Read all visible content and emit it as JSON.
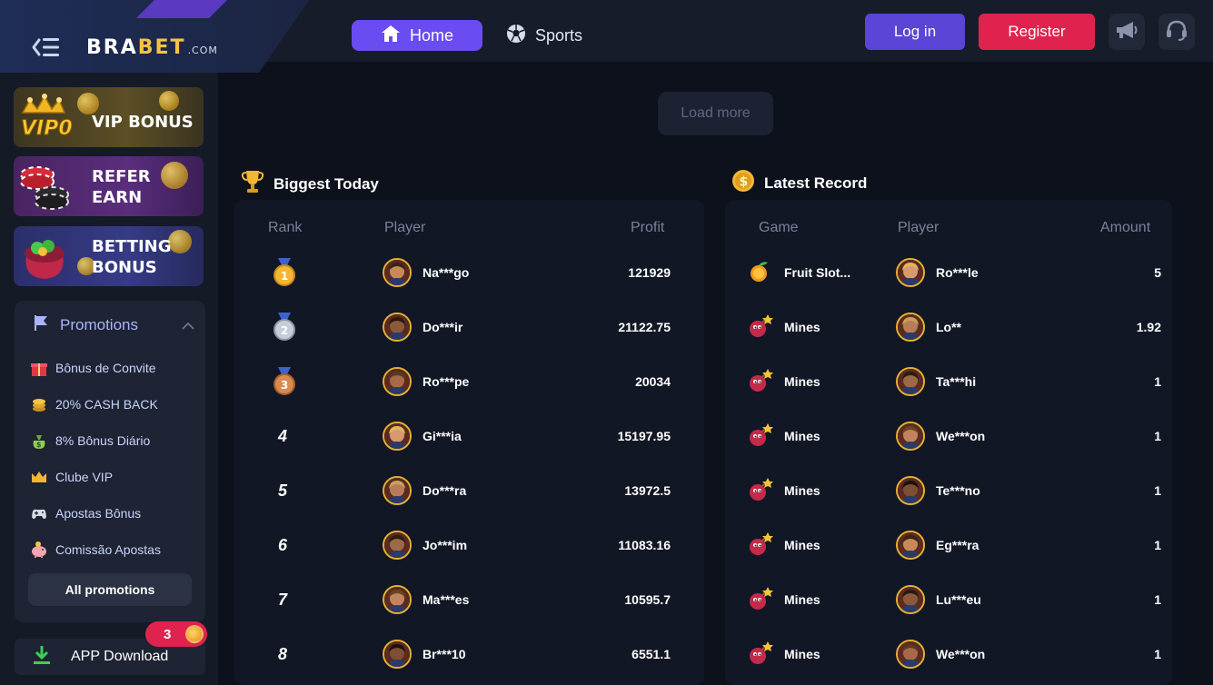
{
  "header": {
    "logo_main": "BRA",
    "logo_accent": "BET",
    "logo_suffix": ".COM",
    "nav_home": "Home",
    "nav_sports": "Sports",
    "login": "Log in",
    "register": "Register"
  },
  "sidebar": {
    "banners": [
      {
        "label_line1": "VIP BONUS",
        "label_line2": ""
      },
      {
        "label_line1": "REFER",
        "label_line2": "EARN"
      },
      {
        "label_line1": "BETTING",
        "label_line2": "BONUS"
      }
    ],
    "vip_badge_text": "VIP0",
    "promotions_title": "Promotions",
    "promotions": [
      {
        "label": "Bônus de Convite",
        "icon": "gift-icon"
      },
      {
        "label": "20% CASH BACK",
        "icon": "coin-stack-icon"
      },
      {
        "label": "8% Bônus Diário",
        "icon": "money-bag-icon"
      },
      {
        "label": "Clube VIP",
        "icon": "crown-icon"
      },
      {
        "label": "Apostas Bônus",
        "icon": "gamepad-icon"
      },
      {
        "label": "Comissão Apostas",
        "icon": "piggy-bank-icon"
      }
    ],
    "all_promotions": "All promotions",
    "app_download": "APP Download",
    "app_badge_count": "3"
  },
  "main": {
    "load_more": "Load more",
    "biggest_today": {
      "title": "Biggest Today",
      "headers": {
        "rank": "Rank",
        "player": "Player",
        "profit": "Profit"
      },
      "rows": [
        {
          "rank": "1",
          "player": "Na***go",
          "profit": "121929"
        },
        {
          "rank": "2",
          "player": "Do***ir",
          "profit": "21122.75"
        },
        {
          "rank": "3",
          "player": "Ro***pe",
          "profit": "20034"
        },
        {
          "rank": "4",
          "player": "Gi***ia",
          "profit": "15197.95"
        },
        {
          "rank": "5",
          "player": "Do***ra",
          "profit": "13972.5"
        },
        {
          "rank": "6",
          "player": "Jo***im",
          "profit": "11083.16"
        },
        {
          "rank": "7",
          "player": "Ma***es",
          "profit": "10595.7"
        },
        {
          "rank": "8",
          "player": "Br***10",
          "profit": "6551.1"
        }
      ]
    },
    "latest_record": {
      "title": "Latest Record",
      "headers": {
        "game": "Game",
        "player": "Player",
        "amount": "Amount"
      },
      "rows": [
        {
          "game": "Fruit Slot...",
          "player": "Ro***le",
          "amount": "5"
        },
        {
          "game": "Mines",
          "player": "Lo**",
          "amount": "1.92"
        },
        {
          "game": "Mines",
          "player": "Ta***hi",
          "amount": "1"
        },
        {
          "game": "Mines",
          "player": "We***on",
          "amount": "1"
        },
        {
          "game": "Mines",
          "player": "Te***no",
          "amount": "1"
        },
        {
          "game": "Mines",
          "player": "Eg***ra",
          "amount": "1"
        },
        {
          "game": "Mines",
          "player": "Lu***eu",
          "amount": "1"
        },
        {
          "game": "Mines",
          "player": "We***on",
          "amount": "1"
        }
      ]
    }
  },
  "colors": {
    "primary_purple": "#6a4cf2",
    "register_red": "#e0234e",
    "background": "#0d111c",
    "panel": "#121725"
  }
}
